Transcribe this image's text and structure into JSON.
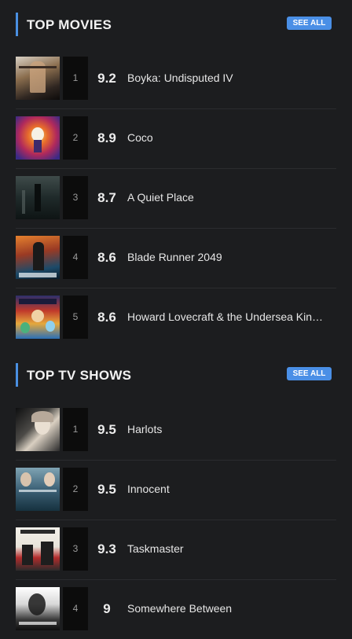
{
  "movies": {
    "title": "TOP MOVIES",
    "see_all": "SEE ALL",
    "items": [
      {
        "rank": "1",
        "score": "9.2",
        "title": "Boyka: Undisputed IV",
        "poster": "boyka-poster"
      },
      {
        "rank": "2",
        "score": "8.9",
        "title": "Coco",
        "poster": "coco-poster"
      },
      {
        "rank": "3",
        "score": "8.7",
        "title": "A Quiet Place",
        "poster": "quiet-place-poster"
      },
      {
        "rank": "4",
        "score": "8.6",
        "title": "Blade Runner 2049",
        "poster": "blade-runner-poster"
      },
      {
        "rank": "5",
        "score": "8.6",
        "title": "Howard Lovecraft & the Undersea Kin…",
        "poster": "howard-lovecraft-poster"
      }
    ]
  },
  "tv": {
    "title": "TOP TV SHOWS",
    "see_all": "SEE ALL",
    "items": [
      {
        "rank": "1",
        "score": "9.5",
        "title": "Harlots",
        "poster": "harlots-poster"
      },
      {
        "rank": "2",
        "score": "9.5",
        "title": "Innocent",
        "poster": "innocent-poster"
      },
      {
        "rank": "3",
        "score": "9.3",
        "title": "Taskmaster",
        "poster": "taskmaster-poster"
      },
      {
        "rank": "4",
        "score": "9",
        "title": "Somewhere Between",
        "poster": "somewhere-between-poster"
      }
    ]
  },
  "colors": {
    "background": "#1c1d1f",
    "accent": "#4a90e2",
    "rank_box": "#0c0c0c",
    "divider": "#2b2c2f"
  }
}
